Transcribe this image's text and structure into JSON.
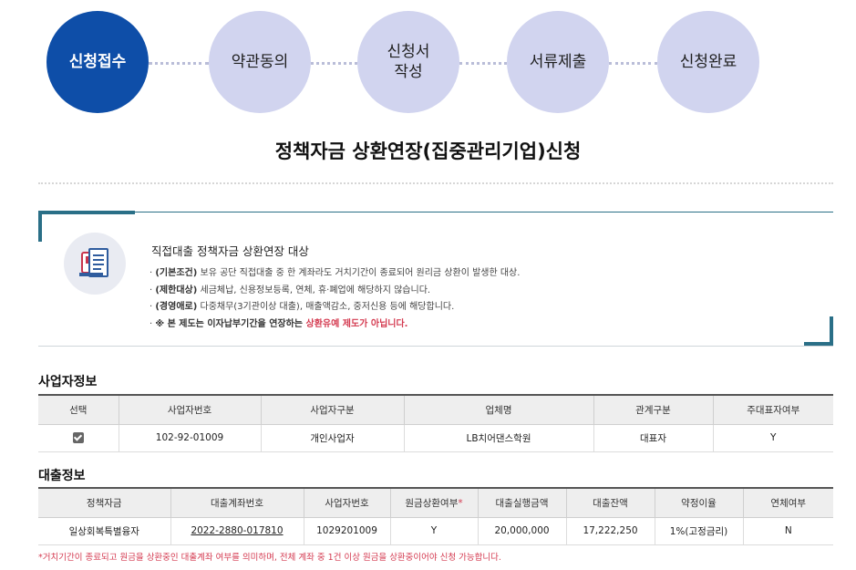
{
  "steps": [
    {
      "label": "신청접수",
      "active": true
    },
    {
      "label": "약관동의",
      "active": false
    },
    {
      "label": "신청서\n작성",
      "active": false
    },
    {
      "label": "서류제출",
      "active": false
    },
    {
      "label": "신청완료",
      "active": false
    }
  ],
  "page_title": "정책자금 상환연장(집중관리기업)신청",
  "notice": {
    "icon": "document-icon",
    "heading": "직접대출 정책자금 상환연장 대상",
    "items": [
      {
        "bold": "(기본조건)",
        "text": " 보유 공단 직접대출 중 한 계좌라도 거치기간이 종료되어 원리금 상환이 발생한 대상."
      },
      {
        "bold": "(제한대상)",
        "text": " 세금체납, 신용정보등록, 연체, 휴·폐업에 해당하지 않습니다."
      },
      {
        "bold": "(경영애로)",
        "text": " 다중채무(3기관이상 대출), 매출액감소, 중저신용 등에 해당합니다."
      }
    ],
    "warning_prefix": "※ 본 제도는 이자납부기간을 연장하는 ",
    "warning_highlight": "상환유예 제도가 아닙니다."
  },
  "business_section": {
    "label": "사업자정보",
    "headers": [
      "선택",
      "사업자번호",
      "사업자구분",
      "업체명",
      "관계구분",
      "주대표자여부"
    ],
    "row": {
      "selected": true,
      "biz_no": "102-92-01009",
      "biz_type": "개인사업자",
      "company": "LB치어댄스학원",
      "relation": "대표자",
      "main_rep": "Y"
    }
  },
  "loan_section": {
    "label": "대출정보",
    "headers": [
      "정책자금",
      "대출계좌번호",
      "사업자번호",
      "원금상환여부",
      "대출실행금액",
      "대출잔액",
      "약정이율",
      "연체여부"
    ],
    "required_mark": "*",
    "row": {
      "fund": "일상회복특별융자",
      "account": "2022-2880-017810",
      "biz_no": "1029201009",
      "repay": "Y",
      "amount": "20,000,000",
      "balance": "17,222,250",
      "rate": "1%(고정금리)",
      "overdue": "N"
    }
  },
  "footnote": "*거치기간이 종료되고 원금을 상환중인 대출계좌 여부를 의미하며, 전체 계좌 중 1건 이상 원금을 상환중이어야 신청 가능합니다.",
  "colors": {
    "active_step": "#0e4ea8",
    "inactive_step": "#d1d4ef",
    "accent_line": "#2a6f87",
    "highlight": "#d43a50"
  }
}
